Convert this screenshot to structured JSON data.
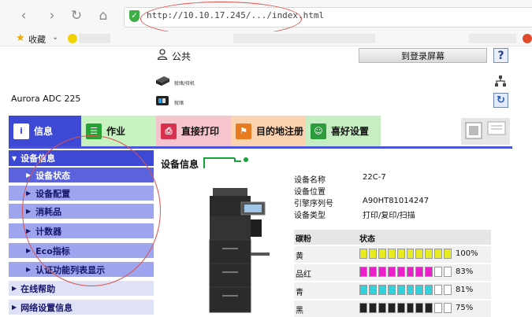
{
  "browser": {
    "url": "http://10.10.17.245/.../index.html",
    "bookmarks_label": "收藏",
    "bookmarks_chevron": "⌄"
  },
  "header": {
    "user_label": "公共",
    "login_button": "到登录屏幕",
    "help_button": "?",
    "device_name": "Aurora ADC 225",
    "status_printer": "就绪/待机",
    "status_toner": "就绪"
  },
  "tabs": [
    {
      "label": "信息",
      "color": "#3d48d4",
      "icon": "info-icon"
    },
    {
      "label": "作业",
      "color": "#c8f3c0",
      "icon": "job-icon"
    },
    {
      "label": "直接打印",
      "color": "#f6c4cc",
      "icon": "direct-print-icon"
    },
    {
      "label": "目的地注册",
      "color": "#fbd3b0",
      "icon": "destination-icon"
    },
    {
      "label": "喜好设置",
      "color": "#c6eec2",
      "icon": "favorites-icon"
    }
  ],
  "sidebar": {
    "header": "设备信息",
    "items": [
      {
        "label": "设备状态",
        "active": true
      },
      {
        "label": "设备配置",
        "active": false
      },
      {
        "label": "消耗品",
        "active": false
      },
      {
        "label": "计数器",
        "active": false
      },
      {
        "label": "Eco指标",
        "active": false
      },
      {
        "label": "认证功能列表显示",
        "active": false
      }
    ],
    "top_items": [
      {
        "label": "在线帮助"
      },
      {
        "label": "网络设置信息"
      }
    ]
  },
  "main": {
    "section_title": "设备信息",
    "info": [
      {
        "label": "设备名称",
        "value": "22C-7"
      },
      {
        "label": "设备位置",
        "value": ""
      },
      {
        "label": "引擎序列号",
        "value": "A90HT81014247"
      },
      {
        "label": "设备类型",
        "value": "打印/复印/扫描"
      }
    ],
    "toner_table": {
      "headers": [
        "碳粉",
        "状态"
      ],
      "rows": [
        {
          "name": "黄",
          "percent": 100,
          "percent_label": "100%",
          "color": "#e7ea1c"
        },
        {
          "name": "品红",
          "percent": 83,
          "percent_label": "83%",
          "color": "#ec1ec9"
        },
        {
          "name": "青",
          "percent": 81,
          "percent_label": "81%",
          "color": "#34d0db"
        },
        {
          "name": "黑",
          "percent": 75,
          "percent_label": "75%",
          "color": "#222222"
        }
      ]
    }
  }
}
